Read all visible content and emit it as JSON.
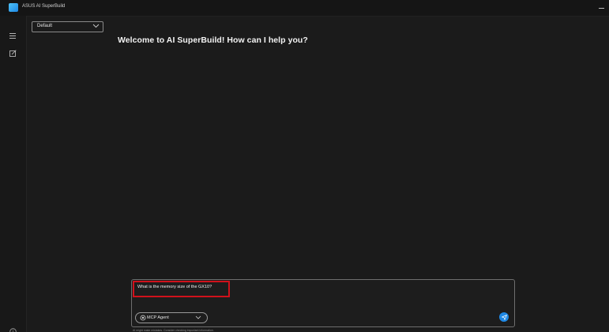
{
  "window": {
    "title": "ASUS AI SuperBuild",
    "minimize_icon": "minimize-icon"
  },
  "sidebar": {
    "menu_icon": "hamburger-menu-icon",
    "new_chat_icon": "new-chat-icon",
    "info_icon": "info-icon"
  },
  "model_selector": {
    "value": "Default"
  },
  "main": {
    "welcome": "Welcome to AI SuperBuild! How can I help you?"
  },
  "composer": {
    "prompt": "What is the memory size of the GX10?",
    "agent_label": "MCP Agent",
    "send_icon": "send-icon",
    "disclaimer": "AI might make mistakes. Consider checking important information."
  },
  "colors": {
    "background": "#1b1b1b",
    "accent": "#1e88e5",
    "highlight": "#d0111b"
  }
}
